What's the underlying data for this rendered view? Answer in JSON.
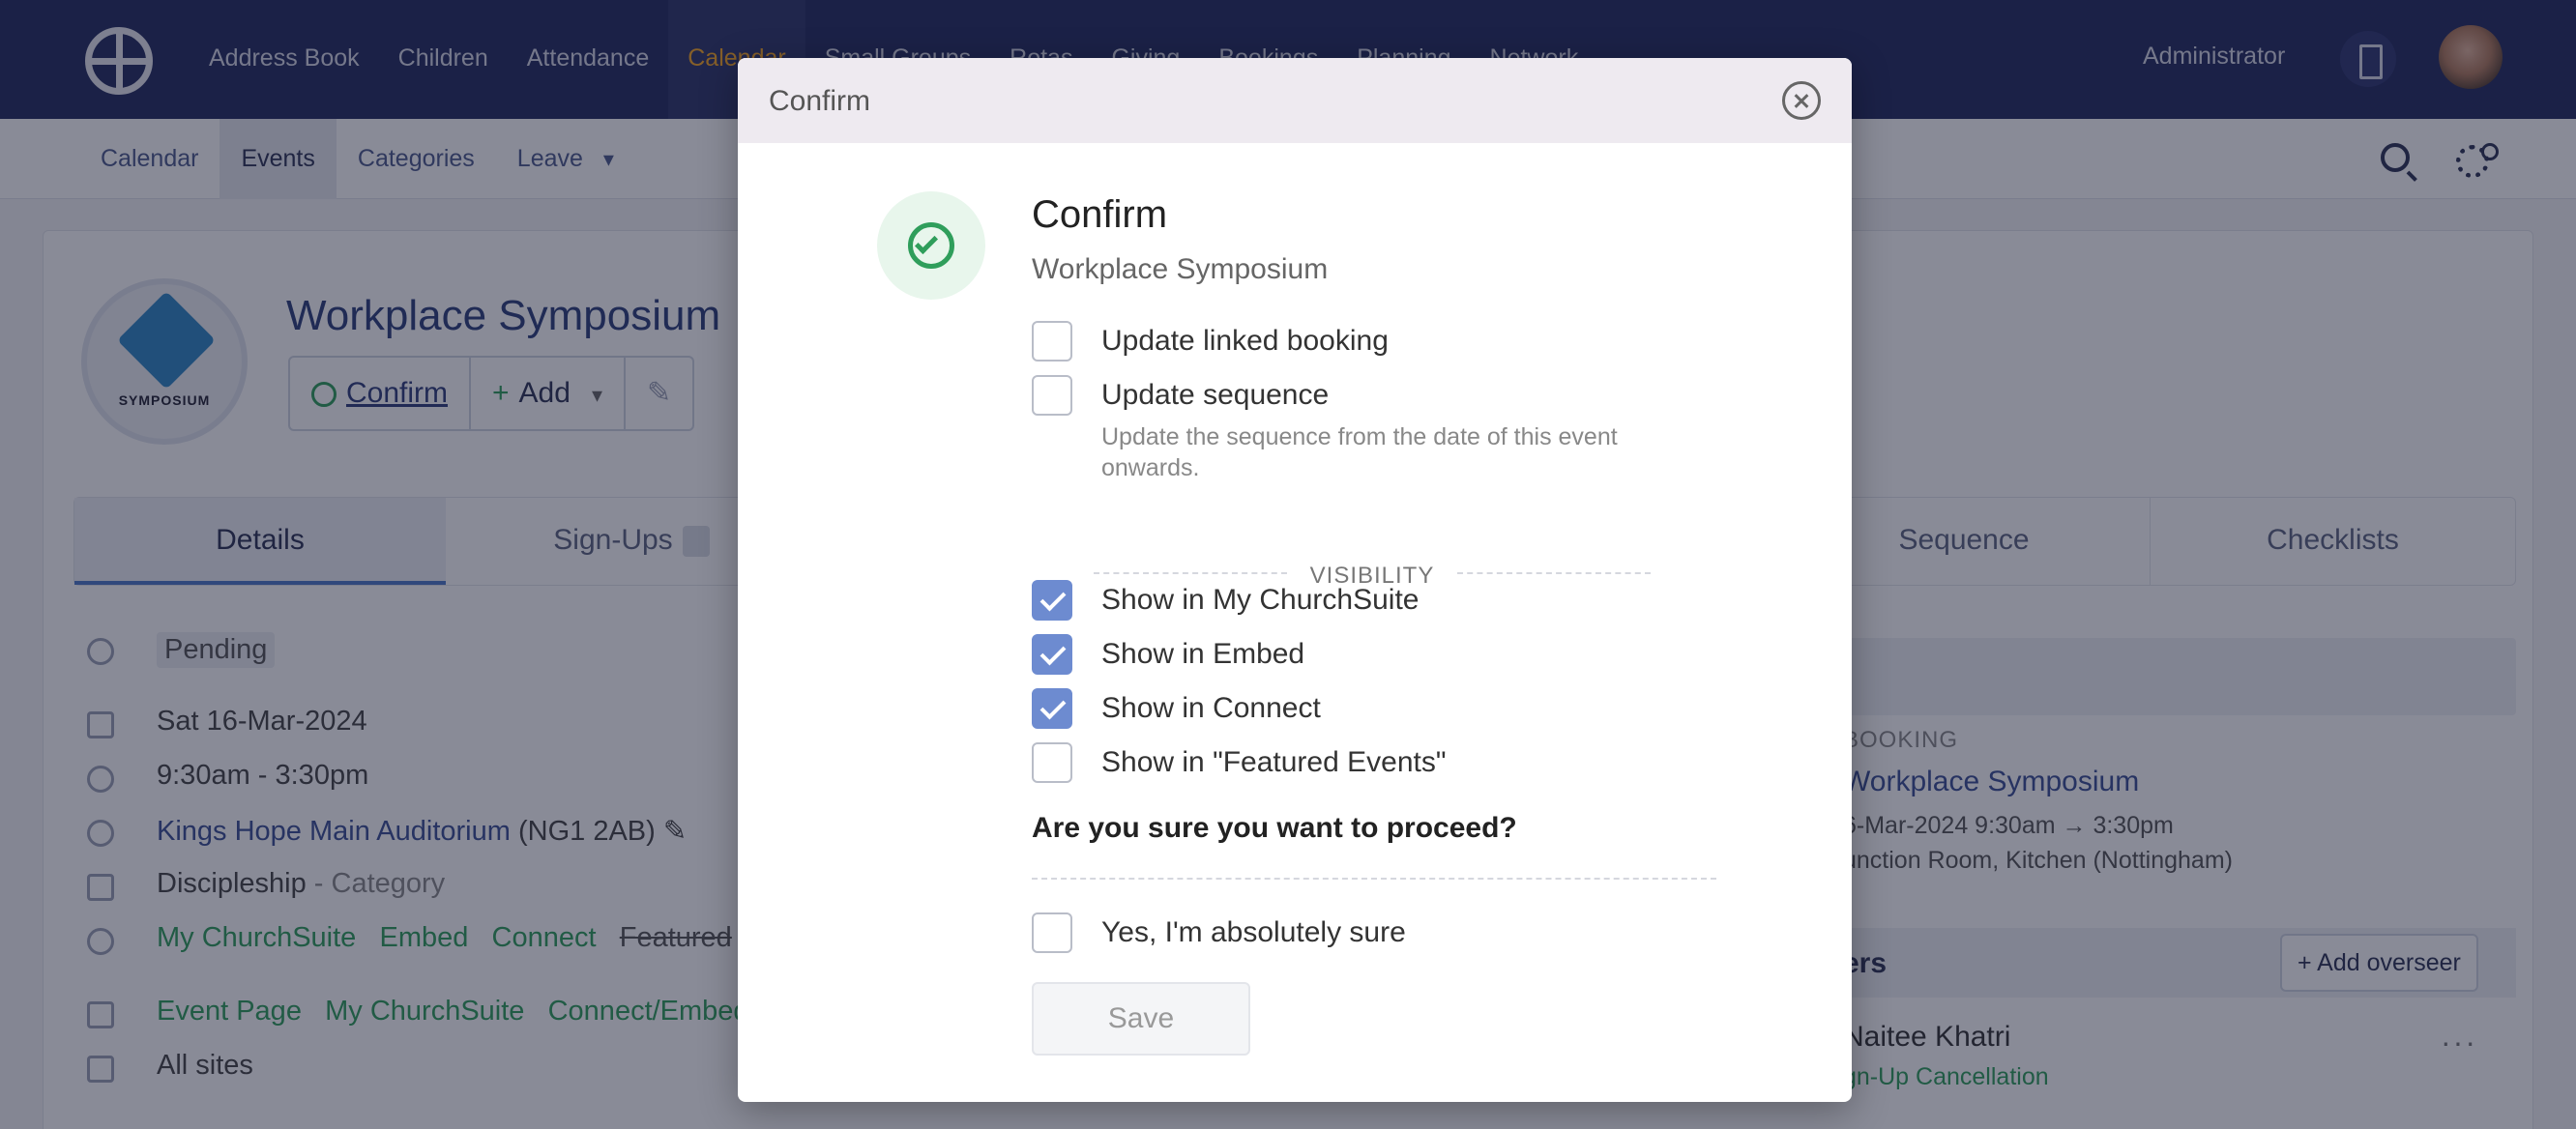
{
  "topnav": {
    "items": [
      "Address Book",
      "Children",
      "Attendance",
      "Calendar",
      "Small Groups",
      "Rotas",
      "Giving",
      "Bookings",
      "Planning",
      "Network"
    ],
    "active_index": 3,
    "user_label": "Administrator"
  },
  "subnav": {
    "items": [
      "Calendar",
      "Events",
      "Categories",
      "Leave"
    ],
    "active_index": 1,
    "leave_caret": "▾"
  },
  "event": {
    "title": "Workplace Symposium",
    "logo_text": "SYMPOSIUM",
    "confirm_label": "Confirm",
    "add_label": "Add",
    "tabs": [
      "Details",
      "Sign-Ups",
      "Sequence",
      "Checklists"
    ],
    "status": "Pending",
    "date": "Sat 16-Mar-2024",
    "time": "9:30am - 3:30pm",
    "location": "Kings Hope Main Auditorium",
    "postcode": "(NG1 2AB)",
    "category": "Discipleship",
    "category_suffix": "- Category",
    "visibility_tags": [
      "My ChurchSuite",
      "Embed",
      "Connect",
      "Featured"
    ],
    "page_links": [
      "Event Page",
      "My ChurchSuite",
      "Connect/Embed"
    ],
    "sites": "All sites",
    "booking_label": "BOOKING",
    "booking_title": "Workplace Symposium",
    "booking_date": "6-Mar-2024 9:30am → 3:30pm",
    "booking_room": "unction Room, Kitchen (Nottingham)",
    "overseers_label": "ers",
    "add_overseer_label": "+ Add overseer",
    "overseer_name": "Naitee Khatri",
    "overseer_tags": "gn-Up   Cancellation"
  },
  "modal": {
    "header_title": "Confirm",
    "title": "Confirm",
    "subtitle": "Workplace Symposium",
    "options": [
      {
        "label": "Update linked booking",
        "checked": false
      },
      {
        "label": "Update sequence",
        "checked": false
      }
    ],
    "sequence_help": "Update the sequence from the date of this event onwards.",
    "visibility_label": "VISIBILITY",
    "visibility_options": [
      {
        "label": "Show in My ChurchSuite",
        "checked": true
      },
      {
        "label": "Show in Embed",
        "checked": true
      },
      {
        "label": "Show in Connect",
        "checked": true
      },
      {
        "label": "Show in \"Featured Events\"",
        "checked": false
      }
    ],
    "question": "Are you sure you want to proceed?",
    "sure_label": "Yes, I'm absolutely sure",
    "sure_checked": false,
    "save_label": "Save"
  },
  "colors": {
    "nav_bg": "#232a5e",
    "accent": "#f6a623",
    "checkbox_checked": "#6d8bd0",
    "success": "#2f9e5b"
  },
  "icons": {
    "logo": "cross-circle-logo",
    "close": "close-icon",
    "status": "check-circle-icon",
    "search": "search-icon",
    "settings": "settings-icon",
    "building": "building-icon"
  }
}
